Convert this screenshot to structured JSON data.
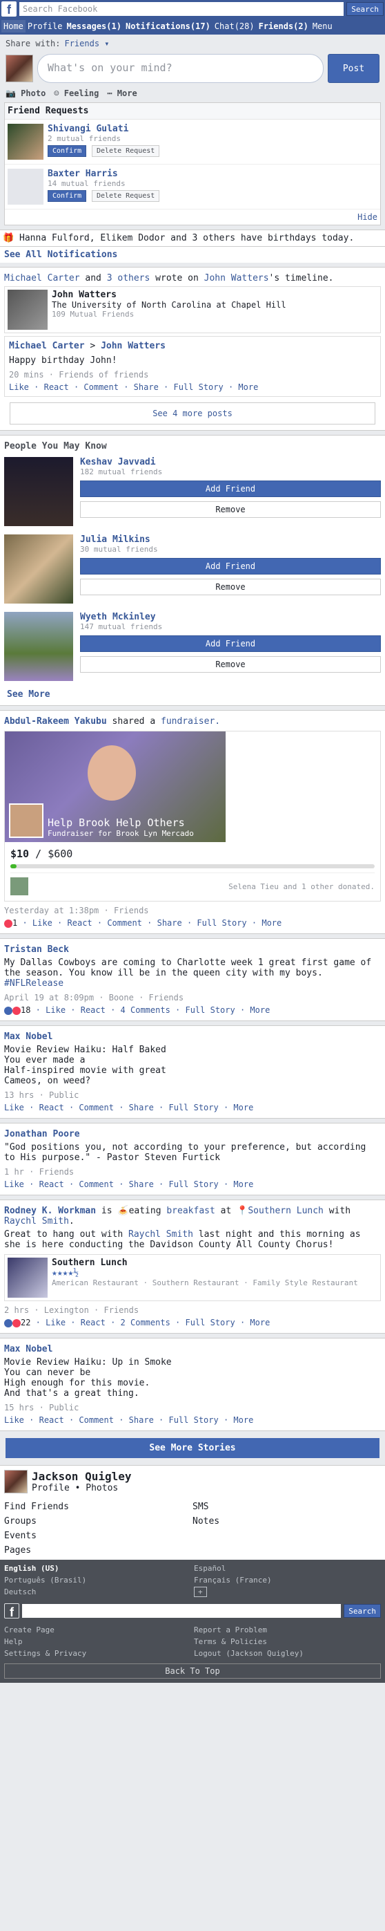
{
  "topbar": {
    "search_placeholder": "Search Facebook",
    "search_button": "Search"
  },
  "nav": [
    "Home",
    "Profile",
    "Messages(1)",
    "Notifications(17)",
    "Chat(28)",
    "Friends(2)",
    "Menu"
  ],
  "composer": {
    "share_with": "Share with:",
    "audience": "Friends ▾",
    "placeholder": "What's on your mind?",
    "post": "Post",
    "photo": "Photo",
    "feeling": "Feeling",
    "more": "More"
  },
  "friend_requests": {
    "title": "Friend Requests",
    "confirm": "Confirm",
    "delete": "Delete Request",
    "hide": "Hide",
    "items": [
      {
        "name": "Shivangi Gulati",
        "mutual": "2 mutual friends"
      },
      {
        "name": "Baxter Harris",
        "mutual": "14 mutual friends"
      }
    ]
  },
  "birthday": "Hanna Fulford, Elikem Dodor and 3 others have birthdays today.",
  "see_all": "See All Notifications",
  "wrote": {
    "a": "Michael Carter",
    "and": "and",
    "b": "3 others",
    "c": "wrote on",
    "d": "John Watters",
    "e": "'s timeline.",
    "card_name": "John Watters",
    "card_school": "The University of North Carolina at Chapel Hill",
    "card_mutual": "109 Mutual Friends",
    "from": "Michael Carter",
    "to": "John Watters",
    "text": "Happy birthday John!",
    "meta": "20 mins · Friends of friends",
    "see_more_posts": "See 4 more posts"
  },
  "actions": [
    "Like",
    "React",
    "Comment",
    "Share",
    "Full Story",
    "More"
  ],
  "pymk": {
    "title": "People You May Know",
    "add": "Add Friend",
    "remove": "Remove",
    "see_more": "See More",
    "people": [
      {
        "name": "Keshav Javvadi",
        "mutual": "182 mutual friends"
      },
      {
        "name": "Julia Milkins",
        "mutual": "30 mutual friends"
      },
      {
        "name": "Wyeth Mckinley",
        "mutual": "147 mutual friends"
      }
    ]
  },
  "fundraiser": {
    "who": "Abdul-Rakeem Yakubu",
    "shared": "shared a",
    "what": "fundraiser.",
    "title": "Help Brook Help Others",
    "sub": "Fundraiser for Brook Lyn Mercado",
    "raised": "$10",
    "slash": "/",
    "goal": "$600",
    "progress": 0.017,
    "donated": "Selena Tieu and 1 other donated.",
    "meta": "Yesterday at 1:38pm · Friends",
    "count": "1"
  },
  "tristan": {
    "name": "Tristan Beck",
    "text": "My Dallas Cowboys are coming to Charlotte week 1 great first game of the season. You know ill be in the queen city with my boys.",
    "tag": "#NFLRelease",
    "meta": "April 19 at 8:09pm · Boone · Friends",
    "count": "18",
    "comments": "4 Comments"
  },
  "max1": {
    "name": "Max Nobel",
    "lines": [
      "Movie Review Haiku: Half Baked",
      "You ever made a",
      "Half-inspired movie with great",
      "Cameos, on weed?"
    ],
    "meta": "13 hrs · Public"
  },
  "jon": {
    "name": "Jonathan Poore",
    "text": "\"God positions you, not according to your preference, but according to His purpose.\" - Pastor Steven Furtick",
    "meta": "1 hr · Friends"
  },
  "rodney": {
    "name": "Rodney K. Workman",
    "is": "is",
    "eating": "eating",
    "breakfast": "breakfast",
    "at": "at",
    "place": "Southern Lunch",
    "with": "with",
    "friend": "Raychl Smith",
    "text1": "Great to hang out with",
    "text2": "last night and this morning as she is here conducting the Davidson County All County Chorus!",
    "card_name": "Southern Lunch",
    "stars": "★★★★½",
    "cats": "American Restaurant · Southern Restaurant · Family Style Restaurant",
    "meta": "2 hrs · Lexington · Friends",
    "count": "22",
    "comments": "2 Comments"
  },
  "max2": {
    "name": "Max Nobel",
    "lines": [
      "Movie Review Haiku: Up in Smoke",
      "You can never be",
      "High enough for this movie.",
      "And that's a great thing."
    ],
    "meta": "15 hrs · Public"
  },
  "see_more_stories": "See More Stories",
  "profile": {
    "name": "Jackson Quigley",
    "profile": "Profile",
    "dot": "•",
    "photos": "Photos"
  },
  "links": [
    "Find Friends",
    "SMS",
    "Groups",
    "Notes",
    "Events",
    "",
    "Pages",
    ""
  ],
  "langs": [
    "English (US)",
    "Español",
    "Português (Brasil)",
    "Français (France)",
    "Deutsch",
    "+"
  ],
  "footer": {
    "search": "Search",
    "links": [
      "Create Page",
      "Report a Problem",
      "Help",
      "Terms & Policies",
      "Settings & Privacy",
      "Logout (Jackson Quigley)"
    ],
    "back": "Back To Top"
  }
}
